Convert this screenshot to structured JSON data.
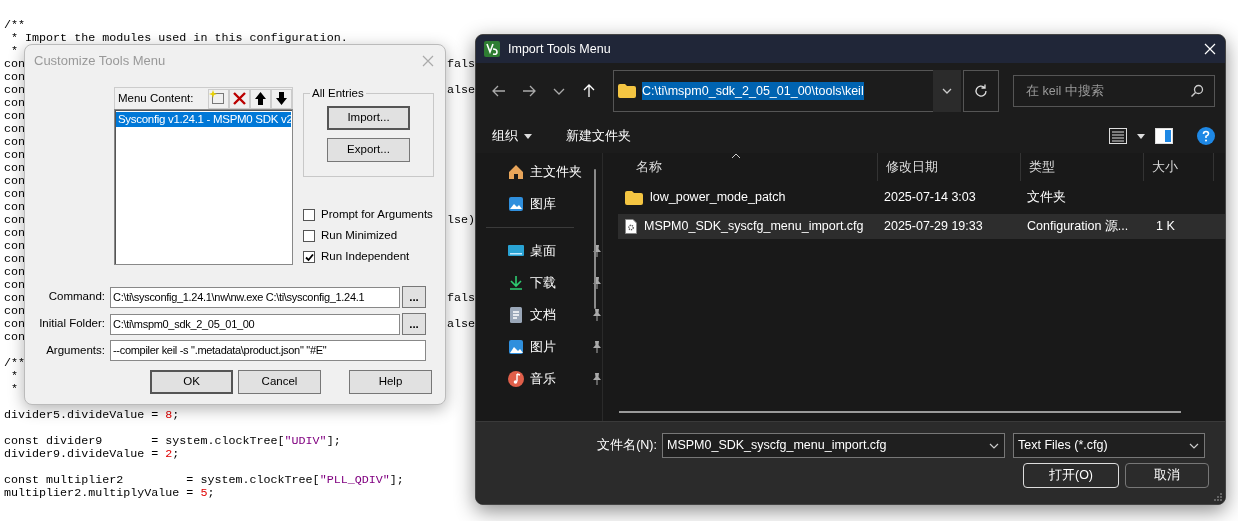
{
  "editor": {
    "lines": [
      {
        "kind": "blank"
      },
      {
        "kind": "blank"
      },
      {
        "kind": "code",
        "parts": [
          {
            "text": "/**",
            "kind": "plain"
          }
        ]
      },
      {
        "kind": "code",
        "parts": [
          {
            "text": " * Import the modules used in this configuration.",
            "kind": "plain"
          }
        ]
      },
      {
        "kind": "code",
        "parts": [
          {
            "text": " *",
            "kind": "plain"
          }
        ]
      },
      {
        "kind": "code",
        "parts": [
          {
            "text": "con",
            "kind": "plain"
          }
        ],
        "tail": "fals"
      },
      {
        "kind": "code",
        "parts": [
          {
            "text": "con",
            "kind": "plain"
          }
        ]
      },
      {
        "kind": "code",
        "parts": [
          {
            "text": "con",
            "kind": "plain"
          }
        ],
        "tail": "alse"
      },
      {
        "kind": "code",
        "parts": [
          {
            "text": "con",
            "kind": "plain"
          }
        ]
      },
      {
        "kind": "code",
        "parts": [
          {
            "text": "con",
            "kind": "plain"
          }
        ]
      },
      {
        "kind": "code",
        "parts": [
          {
            "text": "con",
            "kind": "plain"
          }
        ]
      },
      {
        "kind": "code",
        "parts": [
          {
            "text": "con",
            "kind": "plain"
          }
        ]
      },
      {
        "kind": "code",
        "parts": [
          {
            "text": "con",
            "kind": "plain"
          }
        ]
      },
      {
        "kind": "code",
        "parts": [
          {
            "text": "con",
            "kind": "plain"
          }
        ]
      },
      {
        "kind": "code",
        "parts": [
          {
            "text": "con",
            "kind": "plain"
          }
        ]
      },
      {
        "kind": "code",
        "parts": [
          {
            "text": "con",
            "kind": "plain"
          }
        ]
      },
      {
        "kind": "code",
        "parts": [
          {
            "text": "con",
            "kind": "plain"
          }
        ]
      },
      {
        "kind": "code",
        "parts": [
          {
            "text": "con",
            "kind": "plain"
          }
        ],
        "tail": "lse)"
      },
      {
        "kind": "code",
        "parts": [
          {
            "text": "con",
            "kind": "plain"
          }
        ]
      },
      {
        "kind": "code",
        "parts": [
          {
            "text": "con",
            "kind": "plain"
          }
        ]
      },
      {
        "kind": "code",
        "parts": [
          {
            "text": "con",
            "kind": "plain"
          }
        ]
      },
      {
        "kind": "code",
        "parts": [
          {
            "text": "con",
            "kind": "plain"
          }
        ]
      },
      {
        "kind": "code",
        "parts": [
          {
            "text": "con",
            "kind": "plain"
          }
        ]
      },
      {
        "kind": "code",
        "parts": [
          {
            "text": "con",
            "kind": "plain"
          }
        ],
        "tail": "fals"
      },
      {
        "kind": "code",
        "parts": [
          {
            "text": "con",
            "kind": "plain"
          }
        ]
      },
      {
        "kind": "code",
        "parts": [
          {
            "text": "con",
            "kind": "plain"
          }
        ],
        "tail": "alse"
      },
      {
        "kind": "code",
        "parts": [
          {
            "text": "con",
            "kind": "plain"
          }
        ]
      },
      {
        "kind": "blank"
      },
      {
        "kind": "code",
        "parts": [
          {
            "text": "/**",
            "kind": "plain"
          }
        ]
      },
      {
        "kind": "code",
        "parts": [
          {
            "text": " *",
            "kind": "plain"
          }
        ]
      },
      {
        "kind": "code",
        "parts": [
          {
            "text": " *",
            "kind": "plain"
          }
        ]
      },
      {
        "kind": "blank"
      },
      {
        "kind": "code",
        "parts": [
          {
            "text": "divider5.divideValue = ",
            "kind": "plain"
          },
          {
            "text": "8",
            "kind": "number"
          },
          {
            "text": ";",
            "kind": "plain"
          }
        ]
      },
      {
        "kind": "blank"
      },
      {
        "kind": "code",
        "parts": [
          {
            "text": "const divider9       = system.clockTree[",
            "kind": "plain"
          },
          {
            "text": "\"UDIV\"",
            "kind": "string"
          },
          {
            "text": "];",
            "kind": "plain"
          }
        ]
      },
      {
        "kind": "code",
        "parts": [
          {
            "text": "divider9.divideValue = ",
            "kind": "plain"
          },
          {
            "text": "2",
            "kind": "number"
          },
          {
            "text": ";",
            "kind": "plain"
          }
        ]
      },
      {
        "kind": "blank"
      },
      {
        "kind": "code",
        "parts": [
          {
            "text": "const multiplier2         = system.clockTree[",
            "kind": "plain"
          },
          {
            "text": "\"PLL_QDIV\"",
            "kind": "string"
          },
          {
            "text": "];",
            "kind": "plain"
          }
        ]
      },
      {
        "kind": "code",
        "parts": [
          {
            "text": "multiplier2.multiplyValue = ",
            "kind": "plain"
          },
          {
            "text": "5",
            "kind": "number"
          },
          {
            "text": ";",
            "kind": "plain"
          }
        ]
      }
    ]
  },
  "customize_dialog": {
    "title": "Customize Tools Menu",
    "menu_content_label": "Menu Content:",
    "entries": [
      {
        "label": "Sysconfig v1.24.1 - MSPM0 SDK v2",
        "selected": true
      }
    ],
    "all_entries_label": "All Entries",
    "group_buttons": [
      "Import...",
      "Export..."
    ],
    "options": [
      {
        "label": "Prompt for  Arguments",
        "checked": false
      },
      {
        "label": "Run Minimized",
        "checked": false
      },
      {
        "label": "Run Independent",
        "checked": true
      }
    ],
    "fields": [
      {
        "label": "Command:",
        "value": "C:\\ti\\sysconfig_1.24.1\\nw\\nw.exe C:\\ti\\sysconfig_1.24.1",
        "browse": "..."
      },
      {
        "label": "Initial Folder:",
        "value": "C:\\ti\\mspm0_sdk_2_05_01_00",
        "browse": "..."
      },
      {
        "label": "Arguments:",
        "value": "--compiler keil -s \".metadata\\product.json\" \"#E\""
      }
    ],
    "buttons": [
      "OK",
      "Cancel",
      "Help"
    ]
  },
  "import_dialog": {
    "title": "Import Tools Menu",
    "address": {
      "value": "C:\\ti\\mspm0_sdk_2_05_01_00\\tools\\keil",
      "selected": true
    },
    "search": {
      "placeholder": "在 keil 中搜索"
    },
    "toolbar": [
      {
        "label": "组织",
        "kind": "menu"
      },
      {
        "label": "新建文件夹",
        "kind": "plain"
      }
    ],
    "sidebar": [
      {
        "items": [
          {
            "label": "主文件夹",
            "kind": "home",
            "pinned": false
          },
          {
            "label": "图库",
            "kind": "gallery",
            "pinned": false
          }
        ]
      },
      {
        "items": [
          {
            "label": "桌面",
            "kind": "desktop",
            "pinned": true
          },
          {
            "label": "下载",
            "kind": "download",
            "pinned": true
          },
          {
            "label": "文档",
            "kind": "document",
            "pinned": true
          },
          {
            "label": "图片",
            "kind": "picture",
            "pinned": true
          },
          {
            "label": "音乐",
            "kind": "music",
            "pinned": true
          }
        ]
      }
    ],
    "columns": [
      "名称",
      "修改日期",
      "类型",
      "大小"
    ],
    "rows": [
      {
        "kind": "folder",
        "name": "low_power_mode_patch",
        "date": "2025-07-14 3:03",
        "type": "文件夹",
        "selected": false
      },
      {
        "kind": "file",
        "name": "MSPM0_SDK_syscfg_menu_import.cfg",
        "date": "2025-07-29 19:33",
        "type": "Configuration 源...",
        "size": "1 K",
        "selected": true
      }
    ],
    "file_name": {
      "label": "文件名(N):",
      "value": "MSPM0_SDK_syscfg_menu_import.cfg"
    },
    "file_type": "Text Files (*.cfg)",
    "buttons": [
      "打开(O)",
      "取消"
    ]
  }
}
